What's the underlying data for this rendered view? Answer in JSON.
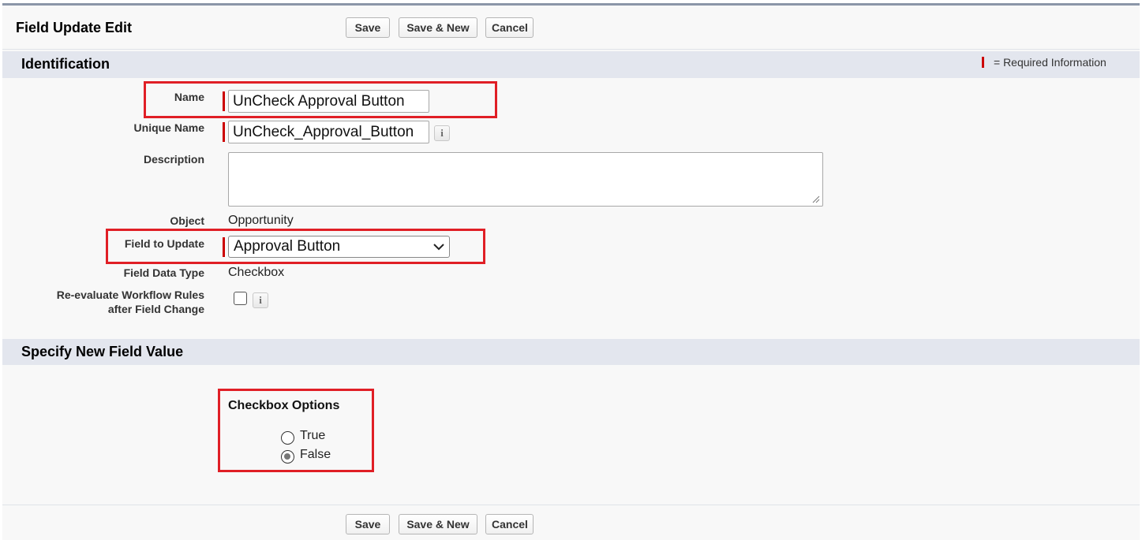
{
  "header": {
    "title": "Field Update Edit",
    "save_label": "Save",
    "save_new_label": "Save & New",
    "cancel_label": "Cancel"
  },
  "identification": {
    "section_title": "Identification",
    "required_info": "= Required Information",
    "name_label": "Name",
    "name_value": "UnCheck Approval Button",
    "unique_name_label": "Unique Name",
    "unique_name_value": "UnCheck_Approval_Button",
    "description_label": "Description",
    "description_value": "",
    "object_label": "Object",
    "object_value": "Opportunity",
    "field_to_update_label": "Field to Update",
    "field_to_update_value": "Approval Button",
    "field_data_type_label": "Field Data Type",
    "field_data_type_value": "Checkbox",
    "reevaluate_label_line1": "Re-evaluate Workflow Rules",
    "reevaluate_label_line2": "after Field Change",
    "reevaluate_checked": false,
    "info_glyph": "i"
  },
  "new_value": {
    "section_title": "Specify New Field Value",
    "checkbox_options_title": "Checkbox Options",
    "option_true": "True",
    "option_false": "False",
    "selected": "False"
  },
  "footer": {
    "save_label": "Save",
    "save_new_label": "Save & New",
    "cancel_label": "Cancel"
  },
  "colors": {
    "required": "#cc0000",
    "highlight_box": "#e01f26",
    "section_bar": "#e3e6ee"
  },
  "icons": {
    "info": "info-icon",
    "dropdown": "chevron-down-icon",
    "resize": "resize-grip-icon"
  }
}
